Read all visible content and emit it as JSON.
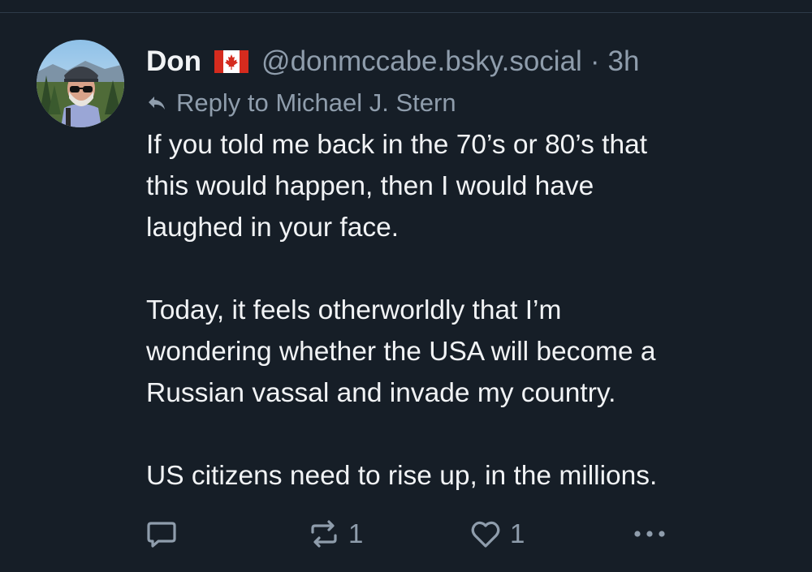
{
  "post": {
    "author": {
      "display_name": "Don",
      "handle": "@donmccabe.bsky.social",
      "flag": "canada-flag"
    },
    "separator": "·",
    "timestamp": "3h",
    "reply_to": "Reply to Michael J. Stern",
    "text": [
      "If you told me back in the 70’s or 80’s that this would happen, then I would have laughed in your face.",
      "Today, it feels otherworldly that I’m wondering whether the USA will become a Russian vassal and invade my country.",
      "US citizens need to rise up, in the millions."
    ],
    "text_lines": [
      [
        "If you told me back in the 70’s or 80’s that",
        "this would happen, then I would have",
        "laughed in your face."
      ],
      [
        "Today, it feels otherworldly that I’m",
        "wondering whether the USA will become a",
        "Russian vassal and invade my country."
      ],
      [
        "US citizens need to rise up, in the millions."
      ]
    ],
    "actions": {
      "reply_icon": "comment-bubble-icon",
      "repost_icon": "repost-icon",
      "repost_count": "1",
      "like_icon": "heart-icon",
      "like_count": "1",
      "more_icon": "more-dots-icon"
    }
  },
  "colors": {
    "background": "#161e27",
    "primary_text": "#f1f3f5",
    "secondary_text": "#8f9dac",
    "divider": "#2e3a48"
  }
}
